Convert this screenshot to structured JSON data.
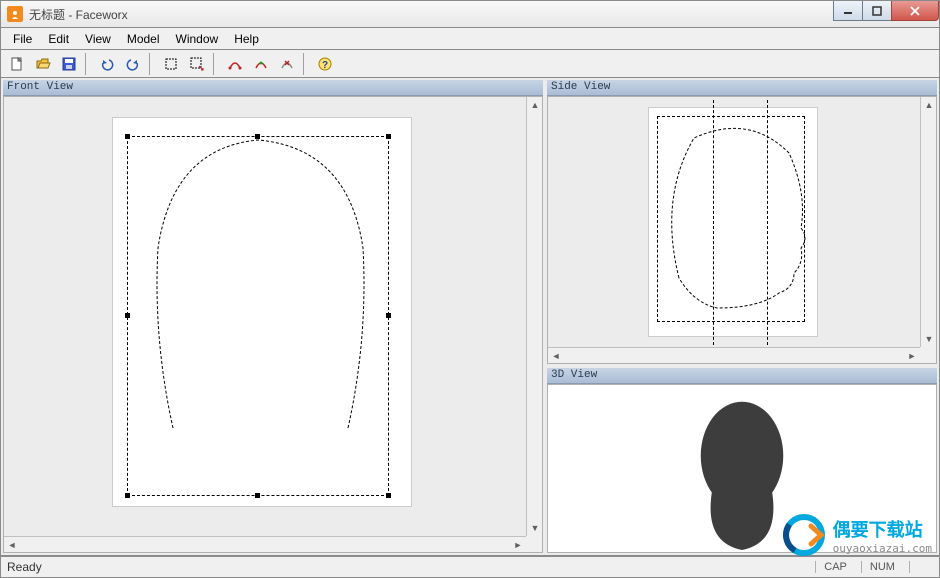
{
  "title": "无标题 - Faceworx",
  "menu": {
    "file": "File",
    "edit": "Edit",
    "view": "View",
    "model": "Model",
    "window": "Window",
    "help": "Help"
  },
  "toolbar": {
    "new": "new-icon",
    "open": "open-icon",
    "save": "save-icon",
    "undo": "undo-icon",
    "redo": "redo-icon",
    "rect": "rect-select-icon",
    "move": "move-points-icon",
    "curve1": "curve-edit-icon",
    "curve2": "curve-add-icon",
    "curve3": "curve-remove-icon",
    "help": "help-icon"
  },
  "panes": {
    "front": "Front View",
    "side": "Side View",
    "v3d": "3D View"
  },
  "status": {
    "ready": "Ready",
    "cap": "CAP",
    "num": "NUM"
  },
  "watermark": {
    "title": "偶要下载站",
    "sub": "ouyaoxiazai.com"
  }
}
